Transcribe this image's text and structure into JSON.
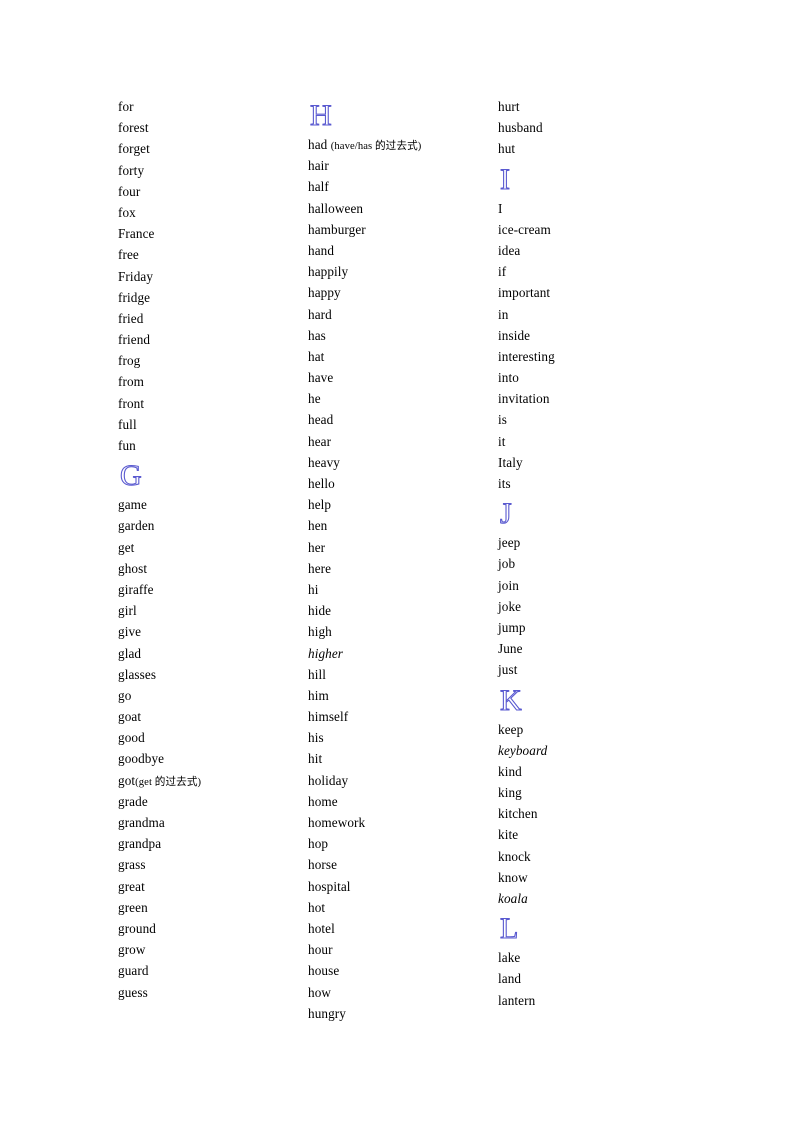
{
  "document": {
    "type": "word-list",
    "page_background": "#ffffff",
    "text_color": "#000000",
    "heading_color": "#5a5ad0",
    "columns": [
      {
        "id": "column-1",
        "blocks": [
          {
            "kind": "entries",
            "items": [
              {
                "text": "for"
              },
              {
                "text": "forest"
              },
              {
                "text": "forget"
              },
              {
                "text": "forty"
              },
              {
                "text": "four"
              },
              {
                "text": "fox"
              },
              {
                "text": "France"
              },
              {
                "text": "free"
              },
              {
                "text": "Friday"
              },
              {
                "text": "fridge"
              },
              {
                "text": "fried"
              },
              {
                "text": "friend"
              },
              {
                "text": "frog"
              },
              {
                "text": "from"
              },
              {
                "text": "front"
              },
              {
                "text": "full"
              },
              {
                "text": "fun"
              }
            ]
          },
          {
            "kind": "heading",
            "letter": "G"
          },
          {
            "kind": "entries",
            "items": [
              {
                "text": "game"
              },
              {
                "text": "garden"
              },
              {
                "text": "get"
              },
              {
                "text": "ghost"
              },
              {
                "text": "giraffe"
              },
              {
                "text": "girl"
              },
              {
                "text": "give"
              },
              {
                "text": "glad"
              },
              {
                "text": "glasses"
              },
              {
                "text": "go"
              },
              {
                "text": "goat"
              },
              {
                "text": "good"
              },
              {
                "text": "goodbye"
              },
              {
                "text": "got",
                "gloss": "(get 的过去式)"
              },
              {
                "text": "grade"
              },
              {
                "text": "grandma"
              },
              {
                "text": "grandpa"
              },
              {
                "text": "grass"
              },
              {
                "text": "great"
              },
              {
                "text": "green"
              },
              {
                "text": "ground"
              },
              {
                "text": "grow"
              },
              {
                "text": "guard"
              },
              {
                "text": "guess"
              }
            ]
          }
        ]
      },
      {
        "id": "column-2",
        "blocks": [
          {
            "kind": "heading",
            "letter": "H"
          },
          {
            "kind": "entries",
            "items": [
              {
                "text": "had ",
                "gloss": "(have/has 的过去式)"
              },
              {
                "text": "hair"
              },
              {
                "text": "half"
              },
              {
                "text": "halloween"
              },
              {
                "text": "hamburger"
              },
              {
                "text": "hand"
              },
              {
                "text": "happily"
              },
              {
                "text": "happy"
              },
              {
                "text": "hard"
              },
              {
                "text": "has"
              },
              {
                "text": "hat"
              },
              {
                "text": "have"
              },
              {
                "text": "he"
              },
              {
                "text": "head"
              },
              {
                "text": "hear"
              },
              {
                "text": "heavy"
              },
              {
                "text": "hello"
              },
              {
                "text": "help"
              },
              {
                "text": "hen"
              },
              {
                "text": "her"
              },
              {
                "text": "here"
              },
              {
                "text": "hi"
              },
              {
                "text": "hide"
              },
              {
                "text": "high"
              },
              {
                "text": "higher",
                "italic": true
              },
              {
                "text": "hill"
              },
              {
                "text": "him"
              },
              {
                "text": "himself"
              },
              {
                "text": "his"
              },
              {
                "text": "hit"
              },
              {
                "text": "holiday"
              },
              {
                "text": "home"
              },
              {
                "text": "homework"
              },
              {
                "text": "hop"
              },
              {
                "text": "horse"
              },
              {
                "text": "hospital"
              },
              {
                "text": "hot"
              },
              {
                "text": "hotel"
              },
              {
                "text": "hour"
              },
              {
                "text": "house"
              },
              {
                "text": "how"
              },
              {
                "text": "hungry"
              }
            ]
          }
        ]
      },
      {
        "id": "column-3",
        "blocks": [
          {
            "kind": "entries",
            "items": [
              {
                "text": "hurt"
              },
              {
                "text": "husband"
              },
              {
                "text": "hut"
              }
            ]
          },
          {
            "kind": "heading",
            "letter": "I"
          },
          {
            "kind": "entries",
            "items": [
              {
                "text": "I"
              },
              {
                "text": "ice-cream"
              },
              {
                "text": "idea"
              },
              {
                "text": "if"
              },
              {
                "text": "important"
              },
              {
                "text": "in"
              },
              {
                "text": "inside"
              },
              {
                "text": "interesting"
              },
              {
                "text": "into"
              },
              {
                "text": "invitation"
              },
              {
                "text": "is"
              },
              {
                "text": "it"
              },
              {
                "text": "Italy"
              },
              {
                "text": "its"
              }
            ]
          },
          {
            "kind": "heading",
            "letter": "J"
          },
          {
            "kind": "entries",
            "items": [
              {
                "text": "jeep"
              },
              {
                "text": "job"
              },
              {
                "text": "join"
              },
              {
                "text": "joke"
              },
              {
                "text": "jump"
              },
              {
                "text": "June"
              },
              {
                "text": "just"
              }
            ]
          },
          {
            "kind": "heading",
            "letter": "K"
          },
          {
            "kind": "entries",
            "items": [
              {
                "text": "keep"
              },
              {
                "text": "keyboard",
                "italic": true
              },
              {
                "text": "kind"
              },
              {
                "text": "king"
              },
              {
                "text": "kitchen"
              },
              {
                "text": "kite"
              },
              {
                "text": "knock"
              },
              {
                "text": "know"
              },
              {
                "text": "koala",
                "italic": true
              }
            ]
          },
          {
            "kind": "heading",
            "letter": "L"
          },
          {
            "kind": "entries",
            "items": [
              {
                "text": "lake"
              },
              {
                "text": "land"
              },
              {
                "text": "lantern"
              }
            ]
          }
        ]
      }
    ]
  }
}
